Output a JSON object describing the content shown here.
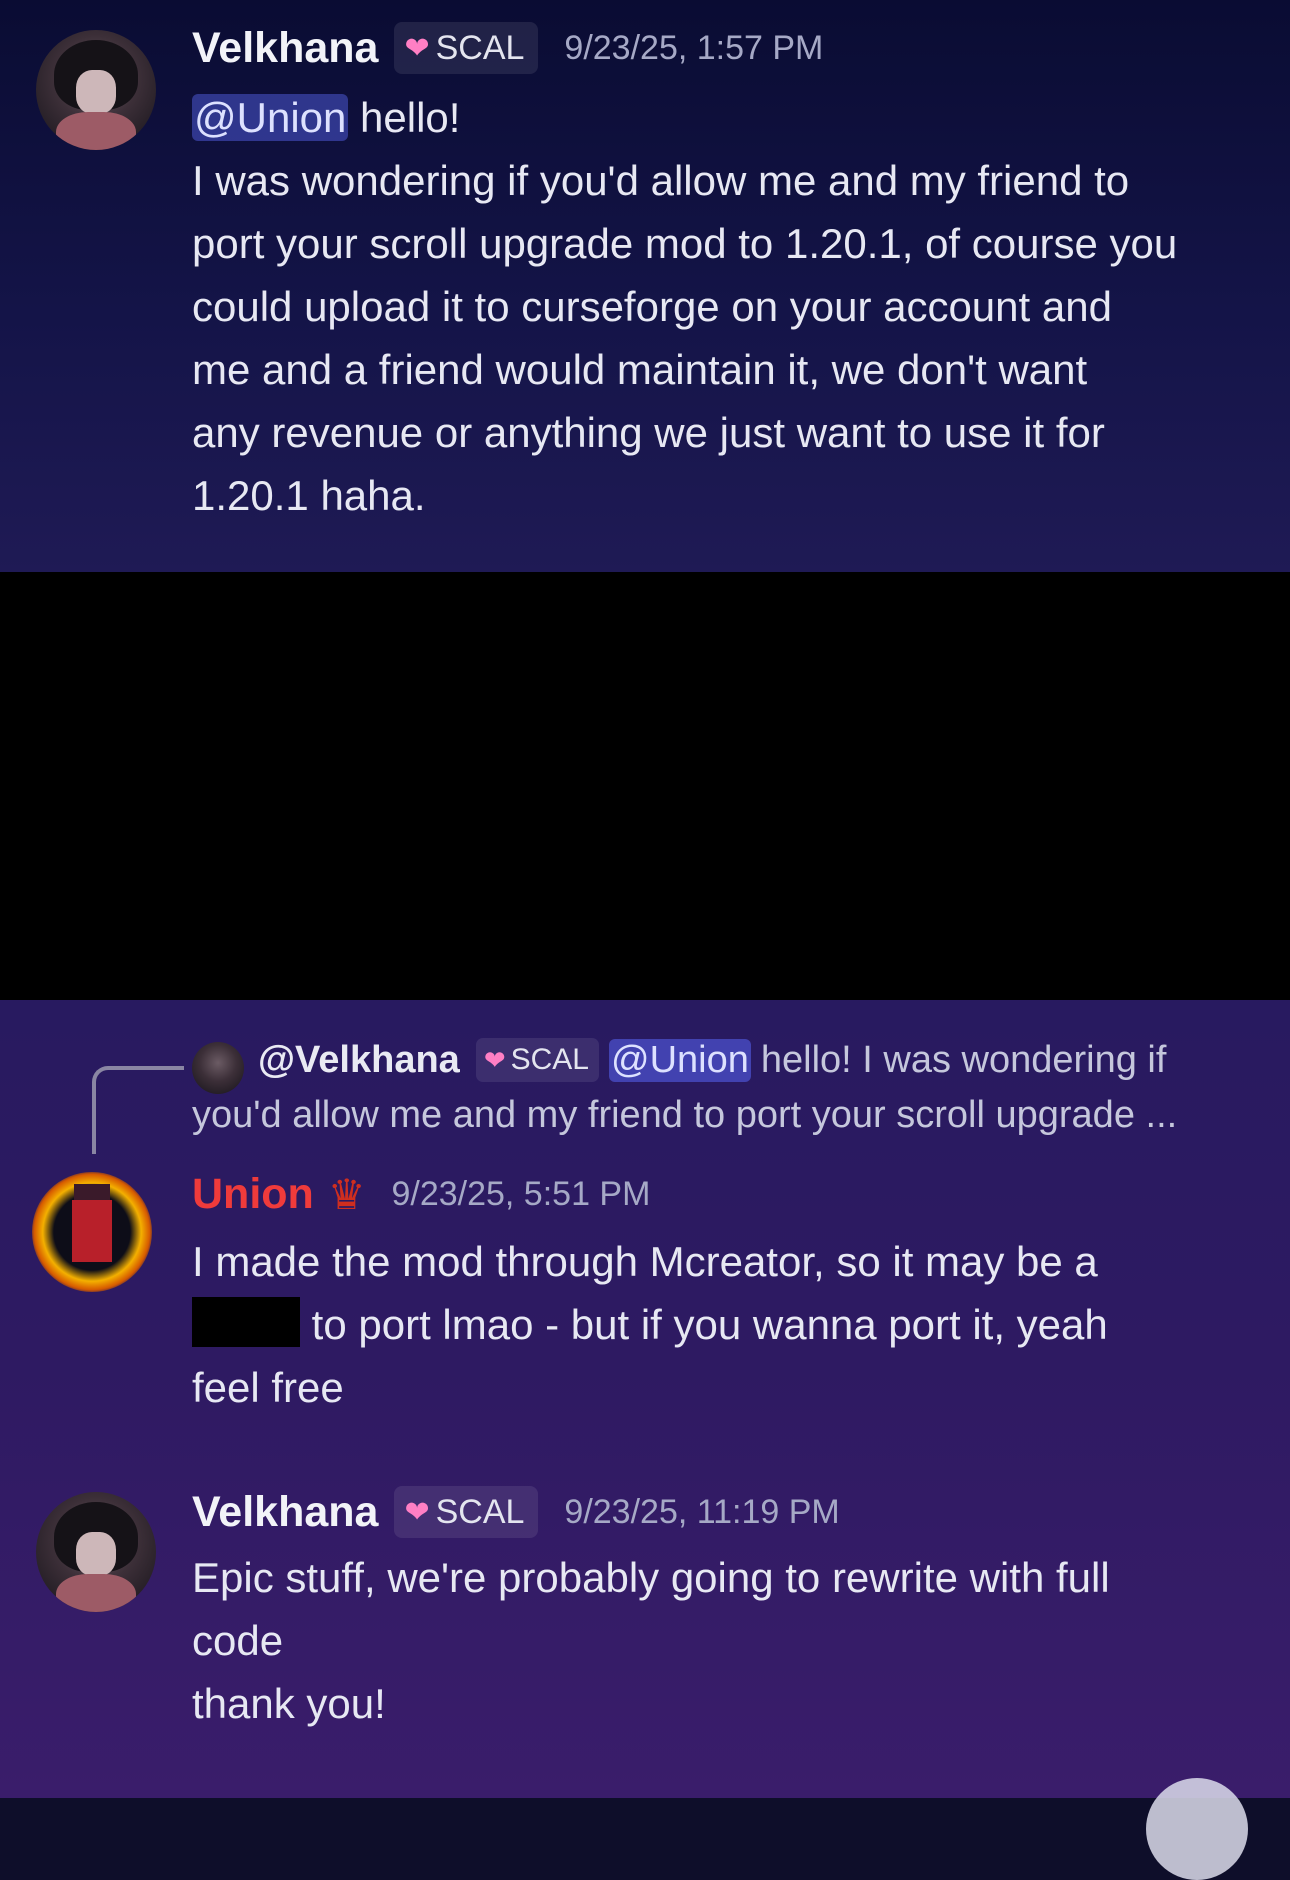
{
  "messages": [
    {
      "username": "Velkhana",
      "tag": "SCAL",
      "timestamp": "9/23/25, 1:57 PM",
      "mention": "@Union",
      "first_line_rest": " hello!",
      "lines": [
        "I was wondering if you'd allow me and my friend to",
        "port your scroll upgrade mod to 1.20.1, of course you",
        "could upload it to curseforge on your account and",
        "me and a friend would maintain it, we don't want",
        "any revenue or anything we just want to use it for",
        "1.20.1 haha."
      ]
    },
    {
      "reply": {
        "username": "@Velkhana",
        "tag": "SCAL",
        "mention": "@Union",
        "text_line1": "hello! I was wondering if",
        "text_line2": "you'd allow me and my friend to port your scroll upgrade ..."
      },
      "username": "Union",
      "timestamp": "9/23/25, 5:51 PM",
      "line1": "I made the mod through Mcreator, so it may be a",
      "line2_after_spoiler": " to port lmao - but if you wanna port it, yeah",
      "line3": "feel free"
    },
    {
      "username": "Velkhana",
      "tag": "SCAL",
      "timestamp": "9/23/25, 11:19 PM",
      "lines": [
        "Epic stuff, we're probably going to rewrite with full",
        "code",
        "thank you!"
      ]
    }
  ],
  "icons": {
    "tag_icon": "heart-icon",
    "role_icon": "crown-icon"
  },
  "colors": {
    "mention_bg": "#5865f2",
    "union_name": "#ef3b3b",
    "heart": "#ff7fc4"
  }
}
